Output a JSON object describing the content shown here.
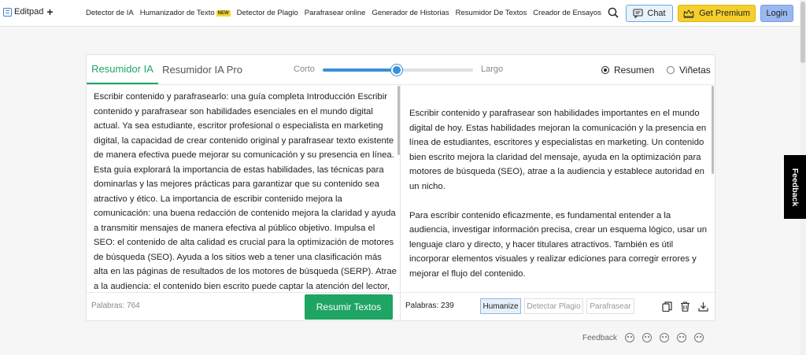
{
  "nav": {
    "logo": "Editpad",
    "logo_plus": "+",
    "items": [
      "Detector de IA",
      "Humanizador de Texto",
      "Detector de Plagio",
      "Parafrasear online",
      "Generador de Historias",
      "Resumidor De Textos",
      "Creador de Ensayos"
    ],
    "new_badge": "NEW",
    "chat": "Chat",
    "premium": "Get Premium",
    "login": "Login"
  },
  "tool": {
    "tabs": [
      "Resumidor IA",
      "Resumidor IA Pro"
    ],
    "length": {
      "min_label": "Corto",
      "max_label": "Largo",
      "value": 0.49
    },
    "modes": [
      {
        "label": "Resumen",
        "selected": true
      },
      {
        "label": "Viñetas",
        "selected": false
      }
    ],
    "input_text": "Escribir contenido y parafrasearlo: una guía completa Introducción Escribir contenido y parafrasear son habilidades esenciales en el mundo digital actual. Ya sea estudiante, escritor profesional o especialista en marketing digital, la capacidad de crear contenido original y parafrasear texto existente de manera efectiva puede mejorar su comunicación y su presencia en línea. Esta guía explorará la importancia de estas habilidades, las técnicas para dominarlas y las mejores prácticas para garantizar que su contenido sea atractivo y ético. La importancia de escribir contenido mejora la comunicación: una buena redacción de contenido mejora la claridad y ayuda a transmitir mensajes de manera efectiva al público objetivo. Impulsa el SEO: el contenido de alta calidad es crucial para la optimización de motores de búsqueda (SEO). Ayuda a los sitios web a tener una clasificación más alta en las páginas de resultados de los motores de búsqueda (SERP). Atrae a la audiencia: el contenido bien escrito puede captar la atención del lector, manteniéndolo",
    "output_paragraphs": [
      "Escribir contenido y parafrasear son habilidades importantes en el mundo digital de hoy. Estas habilidades mejoran la comunicación y la presencia en línea de estudiantes, escritores y especialistas en marketing. Un contenido bien escrito mejora la claridad del mensaje, ayuda en la optimización para motores de búsqueda (SEO), atrae a la audiencia y establece autoridad en un nicho.",
      "Para escribir contenido eficazmente, es fundamental entender a la audiencia, investigar información precisa, crear un esquema lógico, usar un lenguaje claro y directo, y hacer titulares atractivos. También es útil incorporar elementos visuales y realizar ediciones para corregir errores y mejorar el flujo del contenido."
    ],
    "input_words": "Palabras: 764",
    "summarize_button": "Resumir Textos",
    "output_words": "Palabras: 239",
    "chips": [
      {
        "label": "Humanize",
        "active": true
      },
      {
        "label": "Detectar Plagio",
        "active": false
      },
      {
        "label": "Parafrasear",
        "active": false
      }
    ]
  },
  "feedback_tab": "Feedback",
  "feedback_row": {
    "label": "Feedback"
  }
}
